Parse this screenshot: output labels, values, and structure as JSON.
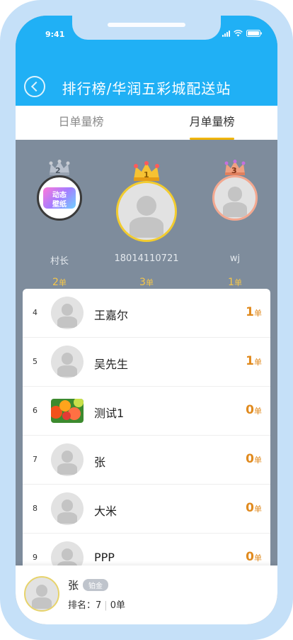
{
  "status_bar": {
    "time": "9:41"
  },
  "header": {
    "title": "排行榜/华润五彩城配送站"
  },
  "tabs": [
    {
      "label": "日单量榜",
      "active": false
    },
    {
      "label": "月单量榜",
      "active": true
    }
  ],
  "podium": {
    "first": {
      "rank_label": "1",
      "name": "18014110721",
      "count": "3",
      "unit": "单"
    },
    "second": {
      "rank_label": "2",
      "name": "村长",
      "count": "2",
      "unit": "单",
      "avatar_text_top": "动态",
      "avatar_text_bottom": "壁纸"
    },
    "third": {
      "rank_label": "3",
      "name": "wj",
      "count": "1",
      "unit": "单"
    }
  },
  "list": [
    {
      "rank": "4",
      "name": "王嘉尔",
      "count": "1",
      "unit": "单",
      "avatar": "default"
    },
    {
      "rank": "5",
      "name": "吴先生",
      "count": "1",
      "unit": "单",
      "avatar": "default"
    },
    {
      "rank": "6",
      "name": "测试1",
      "count": "0",
      "unit": "单",
      "avatar": "fruit"
    },
    {
      "rank": "7",
      "name": "张",
      "count": "0",
      "unit": "单",
      "avatar": "default"
    },
    {
      "rank": "8",
      "name": "大米",
      "count": "0",
      "unit": "单",
      "avatar": "default"
    },
    {
      "rank": "9",
      "name": "PPP",
      "count": "0",
      "unit": "单",
      "avatar": "default"
    }
  ],
  "footer": {
    "name": "张",
    "badge": "铂金",
    "rank_label": "排名：",
    "rank_value": "7",
    "count": "0单"
  },
  "colors": {
    "header_bg": "#20b0f5",
    "podium_bg": "#7e8c9c",
    "accent_gold": "#f0b400",
    "count_orange": "#e08a1e",
    "frame": "#c5e0f8"
  }
}
